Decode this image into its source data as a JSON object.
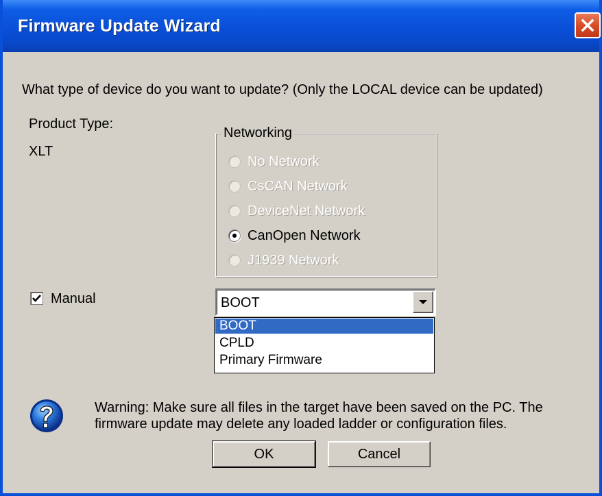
{
  "window": {
    "title": "Firmware Update Wizard",
    "close_icon": "close-icon"
  },
  "prompt": "What type of device do you want to update? (Only the LOCAL device can be updated)",
  "product": {
    "label": "Product Type:",
    "value": "XLT"
  },
  "networking": {
    "legend": "Networking",
    "options": [
      {
        "label": "No Network",
        "enabled": false,
        "selected": false
      },
      {
        "label": "CsCAN Network",
        "enabled": false,
        "selected": false
      },
      {
        "label": "DeviceNet Network",
        "enabled": false,
        "selected": false
      },
      {
        "label": "CanOpen Network",
        "enabled": true,
        "selected": true
      },
      {
        "label": "J1939 Network",
        "enabled": false,
        "selected": false
      }
    ]
  },
  "manual": {
    "label": "Manual",
    "checked": true
  },
  "combo": {
    "value": "BOOT",
    "options": [
      "BOOT",
      "CPLD",
      "Primary Firmware"
    ],
    "selected_index": 0
  },
  "warning": {
    "line1": "Warning:  Make sure all files in the target have been saved on the PC.  The",
    "line2": "firmware update may delete any loaded ladder or configuration files.",
    "icon": "question-icon"
  },
  "buttons": {
    "ok": "OK",
    "cancel": "Cancel"
  },
  "colors": {
    "title_bar": "#0a4fd8",
    "dialog_bg": "#d4d0c8",
    "selection": "#316ac5",
    "close_button": "#d54a24"
  }
}
